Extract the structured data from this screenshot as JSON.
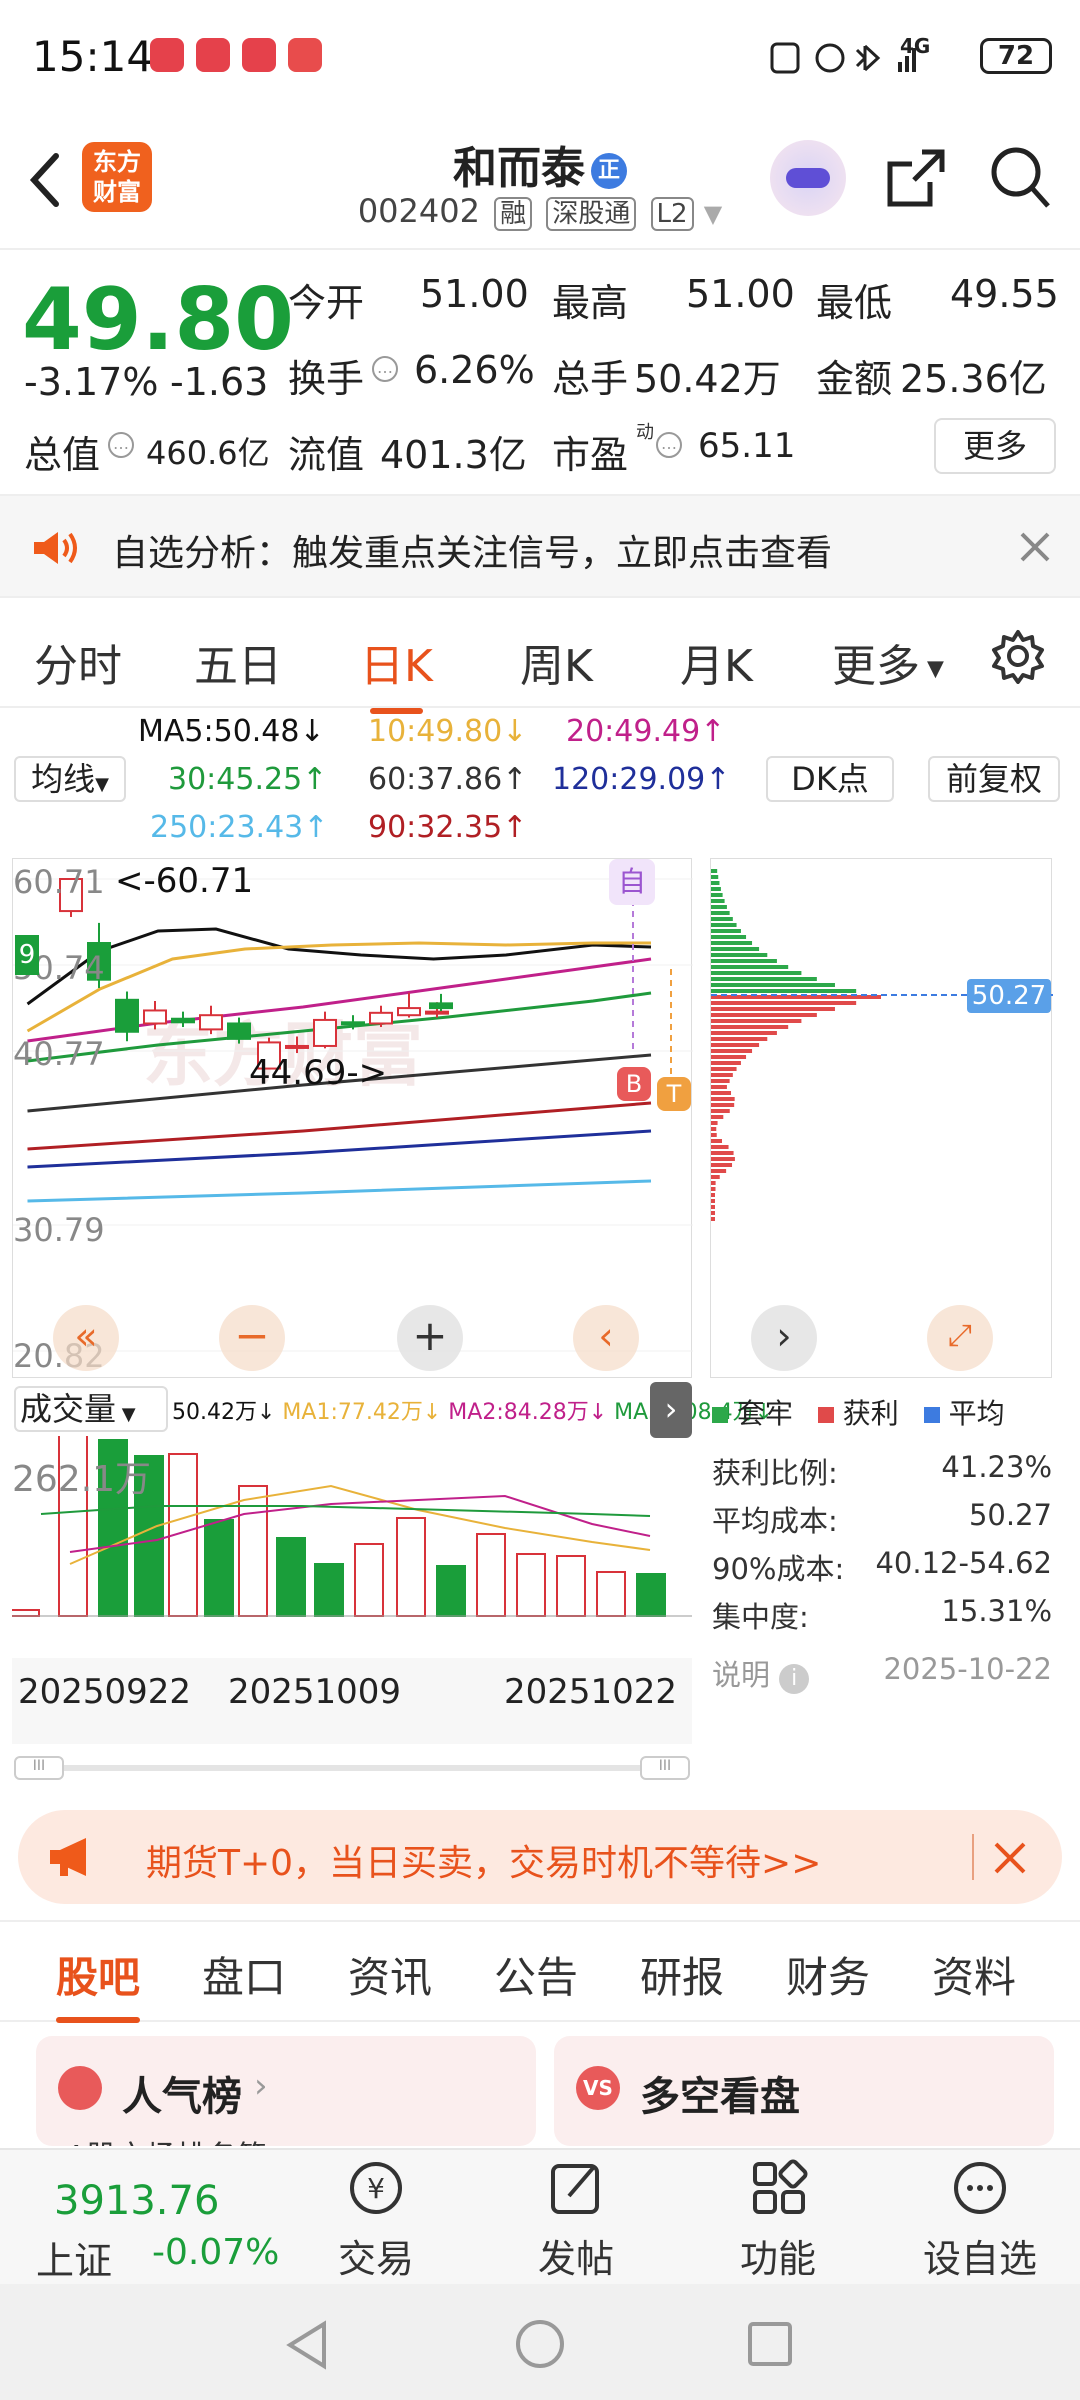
{
  "status_bar": {
    "time": "15:14",
    "network": "4G",
    "battery": "72"
  },
  "header": {
    "stock_name": "和而泰",
    "badge": "正",
    "code": "002402",
    "tags": [
      "融",
      "深股通",
      "L2"
    ],
    "logo_line1": "东方",
    "logo_line2": "财富"
  },
  "quote": {
    "price": "49.80",
    "change_pct": "-3.17%",
    "change": "-1.63",
    "open_label": "今开",
    "open": "51.00",
    "high_label": "最高",
    "high": "51.00",
    "low_label": "最低",
    "low": "49.55",
    "turnover_label": "换手",
    "turnover": "6.26%",
    "volume_label": "总手",
    "volume": "50.42万",
    "amount_label": "金额",
    "amount": "25.36亿",
    "mktcap_label": "总值",
    "mktcap": "460.6亿",
    "float_label": "流值",
    "float_value": "401.3亿",
    "pe_label": "市盈",
    "pe_sup": "动",
    "pe": "65.11",
    "more": "更多"
  },
  "notice": {
    "text": "自选分析：触发重点关注信号，立即点击查看"
  },
  "chart_tabs": [
    "分时",
    "五日",
    "日K",
    "周K",
    "月K",
    "更多"
  ],
  "ma": {
    "selector": "均线",
    "ma5": "MA5:50.48",
    "ma10": "10:49.80",
    "ma20": "20:49.49",
    "ma30": "30:45.25",
    "ma60": "60:37.86",
    "ma120": "120:29.09",
    "ma250": "250:23.43",
    "ma90": "90:32.35",
    "dk": "DK点",
    "fuquan": "前复权"
  },
  "kline": {
    "y_labels": [
      "60.71",
      "50.74",
      "40.77",
      "30.79",
      "20.82"
    ],
    "max_note": "<-60.71",
    "min_note": "44.69->",
    "marker_self": "自",
    "marker_b": "B",
    "marker_t": "T",
    "badge9": "9",
    "watermark": "东方财富"
  },
  "chip": {
    "current": "50.27"
  },
  "volume": {
    "selector": "成交量",
    "vol": "50.42万",
    "ma1": "MA1:77.42万",
    "ma2": "MA2:84.28万",
    "ma3": "MA3:108.4万",
    "max_label": "262.1万",
    "dates": [
      "20250922",
      "20251009",
      "20251022"
    ]
  },
  "chip_stats": {
    "legend": [
      "套牢",
      "获利",
      "平均"
    ],
    "rows": [
      {
        "k": "获利比例:",
        "v": "41.23%"
      },
      {
        "k": "平均成本:",
        "v": "50.27"
      },
      {
        "k": "90%成本:",
        "v": "40.12-54.62"
      },
      {
        "k": "集中度:",
        "v": "15.31%"
      }
    ],
    "explain": "说明",
    "date": "2025-10-22"
  },
  "banner": {
    "text": "期货T+0，当日买卖，交易时机不等待>>"
  },
  "subtabs": [
    "股吧",
    "盘口",
    "资讯",
    "公告",
    "研报",
    "财务",
    "资料"
  ],
  "cards": {
    "left_title": "人气榜",
    "left_sub": "A股市场排名第",
    "right_title": "多空看盘"
  },
  "bottom": {
    "index_value": "3913.76",
    "index_name": "上证",
    "index_change": "-0.07%",
    "nav": [
      "交易",
      "发帖",
      "功能",
      "设自选"
    ]
  },
  "colors": {
    "up": "#d8323a",
    "down": "#1a9e3a",
    "accent": "#e8521c",
    "ma5": "#111111",
    "ma10": "#e8b23a",
    "ma20": "#c0208a",
    "ma30": "#1f9a3c",
    "ma60": "#333333",
    "ma90": "#b01f24",
    "ma120": "#1f2f9a",
    "ma250": "#56b9e8"
  }
}
